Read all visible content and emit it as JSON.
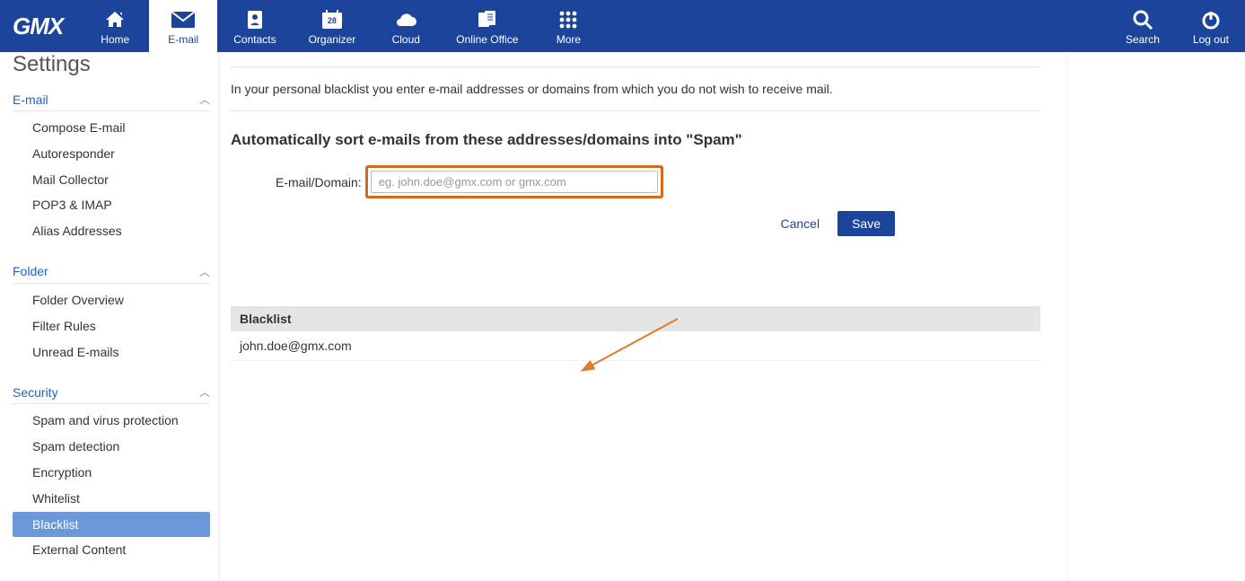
{
  "brand": "GMX",
  "nav": {
    "home": "Home",
    "email": "E-mail",
    "contacts": "Contacts",
    "organizer": "Organizer",
    "organizer_day": "28",
    "cloud": "Cloud",
    "office": "Online Office",
    "more": "More",
    "search": "Search",
    "logout": "Log out"
  },
  "sidebar": {
    "title": "Settings",
    "sections": {
      "email": {
        "label": "E-mail",
        "items": [
          "Compose E-mail",
          "Autoresponder",
          "Mail Collector",
          "POP3 & IMAP",
          "Alias Addresses"
        ]
      },
      "folder": {
        "label": "Folder",
        "items": [
          "Folder Overview",
          "Filter Rules",
          "Unread E-mails"
        ]
      },
      "security": {
        "label": "Security",
        "items": [
          "Spam and virus protection",
          "Spam detection",
          "Encryption",
          "Whitelist",
          "Blacklist",
          "External Content"
        ]
      }
    }
  },
  "main": {
    "description": "In your personal blacklist you enter e-mail addresses or domains from which you do not wish to receive mail.",
    "heading": "Automatically sort e-mails from these addresses/domains into \"Spam\"",
    "field_label": "E-mail/Domain:",
    "placeholder": "eg. john.doe@gmx.com or gmx.com",
    "cancel": "Cancel",
    "save": "Save",
    "list_header": "Blacklist",
    "entries": [
      "john.doe@gmx.com"
    ]
  }
}
